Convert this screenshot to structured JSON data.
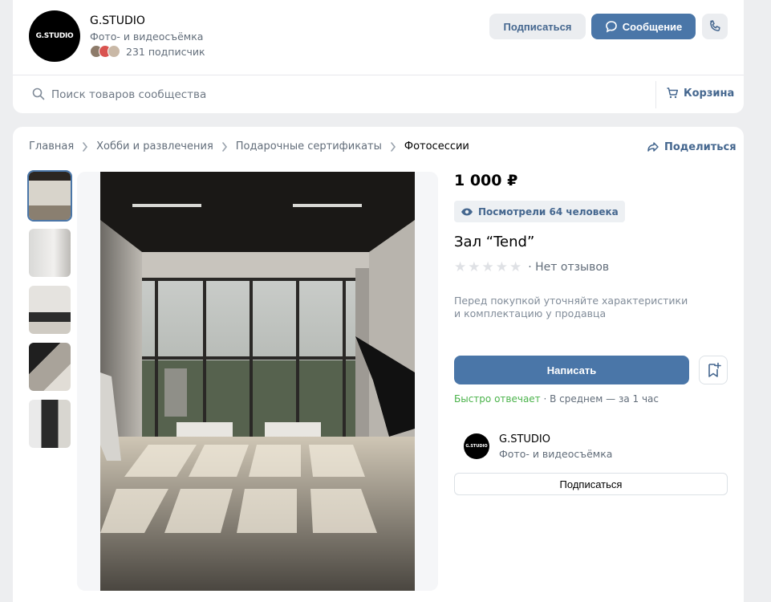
{
  "header": {
    "avatar_text": "G.STUDIO",
    "name": "G.STUDIO",
    "category": "Фото- и видеосъёмка",
    "members_count": "231 подписчик",
    "subscribe_label": "Подписаться",
    "message_label": "Сообщение"
  },
  "search": {
    "placeholder": "Поиск товаров сообщества",
    "cart_label": "Корзина"
  },
  "breadcrumb": {
    "items": [
      "Главная",
      "Хобби и развлечения",
      "Подарочные сертификаты"
    ],
    "current": "Фотосессии",
    "share_label": "Поделиться"
  },
  "product": {
    "price": "1 000 ₽",
    "views": "Посмотрели 64 человека",
    "title": "Зал “Tend”",
    "rating_stars": 0,
    "reviews": "· Нет отзывов",
    "hint": "Перед покупкой уточняйте характеристики и комплектацию у продавца",
    "write_label": "Написать",
    "reply_fast": "Быстро отвечает",
    "reply_time": " · В среднем — за 1 час"
  },
  "seller": {
    "avatar_text": "G.STUDIO",
    "name": "G.STUDIO",
    "category": "Фото- и видеосъёмка",
    "subscribe_label": "Подписаться"
  },
  "colors": {
    "accent": "#4a76a8",
    "link": "#45678f",
    "success": "#4bb34b"
  }
}
